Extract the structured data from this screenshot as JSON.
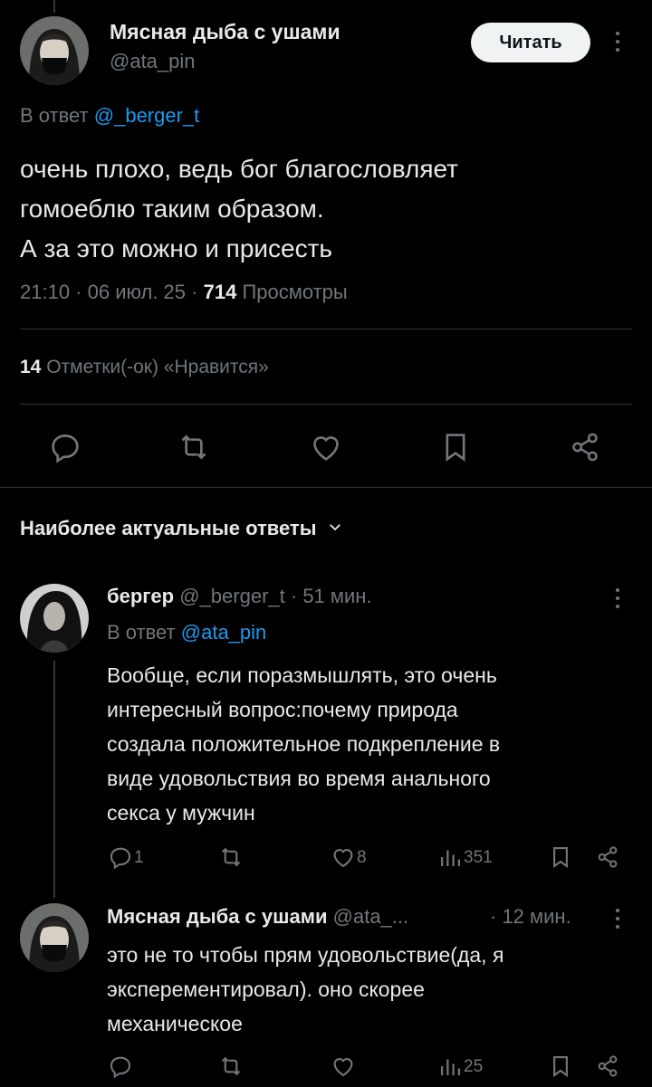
{
  "main_tweet": {
    "author_name": "Мясная дыба с ушами",
    "author_handle": "@ata_pin",
    "follow_label": "Читать",
    "reply_prefix": "В ответ",
    "reply_to": "@_berger_t",
    "text_lines": [
      "очень плохо, ведь бог благословляет",
      "гомоеблю таким образом.",
      "А за это можно и присесть"
    ],
    "time": "21:10 · 06 июл. 25 ·",
    "views_count": "714",
    "views_label": "Просмотры",
    "likes_count": "14",
    "likes_label": "Отметки(-ок) «Нравится»"
  },
  "replies_header": {
    "label": "Наиболее актуальные ответы"
  },
  "replies": [
    {
      "author_name": "бергер",
      "author_handle": "@_berger_t",
      "time": "· 51 мин.",
      "reply_prefix": "В ответ",
      "reply_to": "@ata_pin",
      "text_lines": [
        "Вообще, если поразмышлять, это очень",
        "интересный вопрос:почему природа",
        "создала положительное подкрепление в",
        "виде удовольствия во время анального",
        "секса у мужчин"
      ],
      "reply_count": "1",
      "like_count": "8",
      "views_count": "351"
    },
    {
      "author_name": "Мясная дыба с ушами",
      "author_handle": "@ata_...",
      "time": "· 12 мин.",
      "text_lines": [
        "это не то чтобы прям удовольствие(да, я",
        "эксперементировал). оно скорее",
        "механическое"
      ],
      "views_count": "25"
    }
  ],
  "colors": {
    "background": "#000000",
    "text": "#e7e9ea",
    "muted": "#71767b",
    "link": "#1d9bf0",
    "divider": "#2f3336"
  },
  "icons": [
    "reply-icon",
    "retweet-icon",
    "like-icon",
    "bookmark-icon",
    "share-icon",
    "views-icon",
    "more-icon",
    "chevron-down-icon"
  ]
}
